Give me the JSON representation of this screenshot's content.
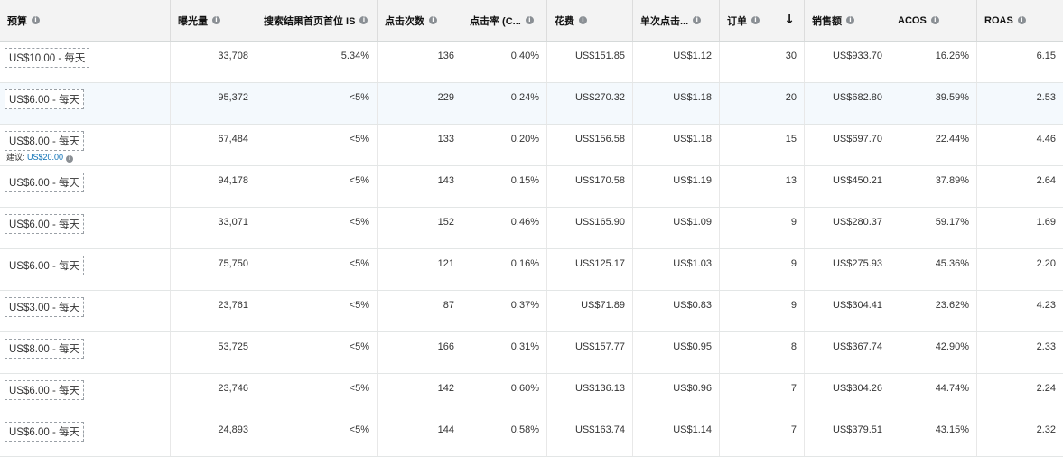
{
  "columns": [
    {
      "key": "budget",
      "label": "预算",
      "info": true
    },
    {
      "key": "impressions",
      "label": "曝光量",
      "info": true
    },
    {
      "key": "top_is",
      "label": "搜索结果首页首位 IS",
      "info": true
    },
    {
      "key": "clicks",
      "label": "点击次数",
      "info": true
    },
    {
      "key": "ctr",
      "label": "点击率 (C...",
      "info": true
    },
    {
      "key": "spend",
      "label": "花费",
      "info": true
    },
    {
      "key": "cpc",
      "label": "单次点击...",
      "info": true
    },
    {
      "key": "orders",
      "label": "订单",
      "info": true,
      "sort": "↓"
    },
    {
      "key": "sales",
      "label": "销售额",
      "info": true
    },
    {
      "key": "acos",
      "label": "ACOS",
      "info": true
    },
    {
      "key": "roas",
      "label": "ROAS",
      "info": true
    }
  ],
  "rows": [
    {
      "budget": "US$10.00 - 每天",
      "impressions": "33,708",
      "top_is": "5.34%",
      "clicks": "136",
      "ctr": "0.40%",
      "spend": "US$151.85",
      "cpc": "US$1.12",
      "orders": "30",
      "sales": "US$933.70",
      "acos": "16.26%",
      "roas": "6.15"
    },
    {
      "budget": "US$6.00 - 每天",
      "impressions": "95,372",
      "top_is": "<5%",
      "clicks": "229",
      "ctr": "0.24%",
      "spend": "US$270.32",
      "cpc": "US$1.18",
      "orders": "20",
      "sales": "US$682.80",
      "acos": "39.59%",
      "roas": "2.53",
      "highlight": true
    },
    {
      "budget": "US$8.00 - 每天",
      "suggest_label": "建议:",
      "suggest_value": "US$20.00",
      "impressions": "67,484",
      "top_is": "<5%",
      "clicks": "133",
      "ctr": "0.20%",
      "spend": "US$156.58",
      "cpc": "US$1.18",
      "orders": "15",
      "sales": "US$697.70",
      "acos": "22.44%",
      "roas": "4.46"
    },
    {
      "budget": "US$6.00 - 每天",
      "impressions": "94,178",
      "top_is": "<5%",
      "clicks": "143",
      "ctr": "0.15%",
      "spend": "US$170.58",
      "cpc": "US$1.19",
      "orders": "13",
      "sales": "US$450.21",
      "acos": "37.89%",
      "roas": "2.64"
    },
    {
      "budget": "US$6.00 - 每天",
      "impressions": "33,071",
      "top_is": "<5%",
      "clicks": "152",
      "ctr": "0.46%",
      "spend": "US$165.90",
      "cpc": "US$1.09",
      "orders": "9",
      "sales": "US$280.37",
      "acos": "59.17%",
      "roas": "1.69"
    },
    {
      "budget": "US$6.00 - 每天",
      "impressions": "75,750",
      "top_is": "<5%",
      "clicks": "121",
      "ctr": "0.16%",
      "spend": "US$125.17",
      "cpc": "US$1.03",
      "orders": "9",
      "sales": "US$275.93",
      "acos": "45.36%",
      "roas": "2.20"
    },
    {
      "budget": "US$3.00 - 每天",
      "impressions": "23,761",
      "top_is": "<5%",
      "clicks": "87",
      "ctr": "0.37%",
      "spend": "US$71.89",
      "cpc": "US$0.83",
      "orders": "9",
      "sales": "US$304.41",
      "acos": "23.62%",
      "roas": "4.23"
    },
    {
      "budget": "US$8.00 - 每天",
      "impressions": "53,725",
      "top_is": "<5%",
      "clicks": "166",
      "ctr": "0.31%",
      "spend": "US$157.77",
      "cpc": "US$0.95",
      "orders": "8",
      "sales": "US$367.74",
      "acos": "42.90%",
      "roas": "2.33"
    },
    {
      "budget": "US$6.00 - 每天",
      "impressions": "23,746",
      "top_is": "<5%",
      "clicks": "142",
      "ctr": "0.60%",
      "spend": "US$136.13",
      "cpc": "US$0.96",
      "orders": "7",
      "sales": "US$304.26",
      "acos": "44.74%",
      "roas": "2.24"
    },
    {
      "budget": "US$6.00 - 每天",
      "impressions": "24,893",
      "top_is": "<5%",
      "clicks": "144",
      "ctr": "0.58%",
      "spend": "US$163.74",
      "cpc": "US$1.14",
      "orders": "7",
      "sales": "US$379.51",
      "acos": "43.15%",
      "roas": "2.32"
    }
  ]
}
